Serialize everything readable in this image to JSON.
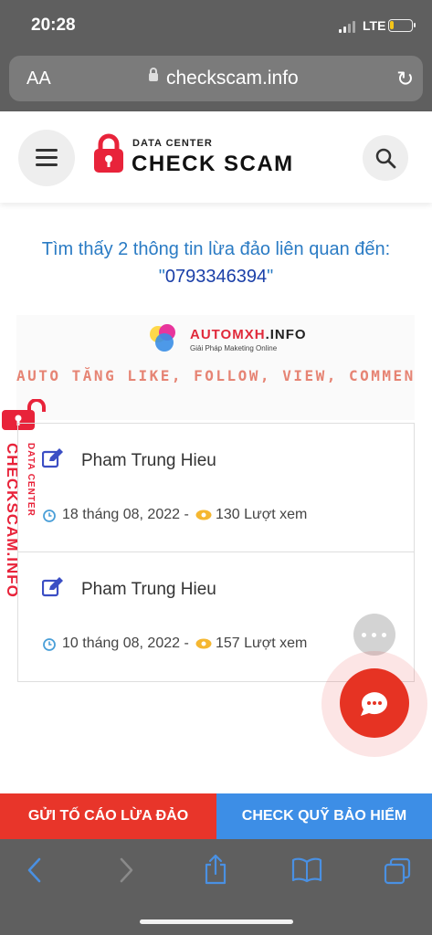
{
  "status_bar": {
    "time": "20:28",
    "network": "LTE",
    "battery_percent": 20
  },
  "browser": {
    "text_size_label": "AA",
    "url": "checkscam.info"
  },
  "header": {
    "logo_small": "DATA CENTER",
    "logo_big": "CHECK SCAM"
  },
  "result": {
    "heading": "Tìm thấy 2 thông tin lừa đảo liên quan đến:",
    "phone": "0793346394"
  },
  "ad": {
    "brand_red": "AUTOMXH",
    "brand_dark": ".INFO",
    "tagline": "Giải Pháp Maketing Online",
    "slogan": "AUTO TĂNG LIKE, FOLLOW, VIEW, COMMEN"
  },
  "watermark": {
    "big": "CHECKSCAM.INFO",
    "small": "DATA CENTER"
  },
  "results": [
    {
      "name": "Pham Trung Hieu",
      "date": "18 tháng 08, 2022 -",
      "views": "130 Lượt xem"
    },
    {
      "name": "Pham Trung Hieu",
      "date": "10 tháng 08, 2022 -",
      "views": "157 Lượt xem"
    }
  ],
  "actions": {
    "report": "GỬI TỐ CÁO LỪA ĐẢO",
    "insurance": "CHECK QUỸ BẢO HIỂM"
  },
  "colors": {
    "brand_red": "#e8233a",
    "link_blue": "#2a7bc4",
    "report_red": "#e8352a",
    "insurance_blue": "#3d8ee6"
  },
  "icons": [
    "menu-icon",
    "search-icon",
    "lock-icon",
    "edit-icon",
    "clock-icon",
    "eye-icon",
    "chat-icon",
    "more-icon",
    "back-icon",
    "forward-icon",
    "share-icon",
    "bookmarks-icon",
    "tabs-icon"
  ]
}
